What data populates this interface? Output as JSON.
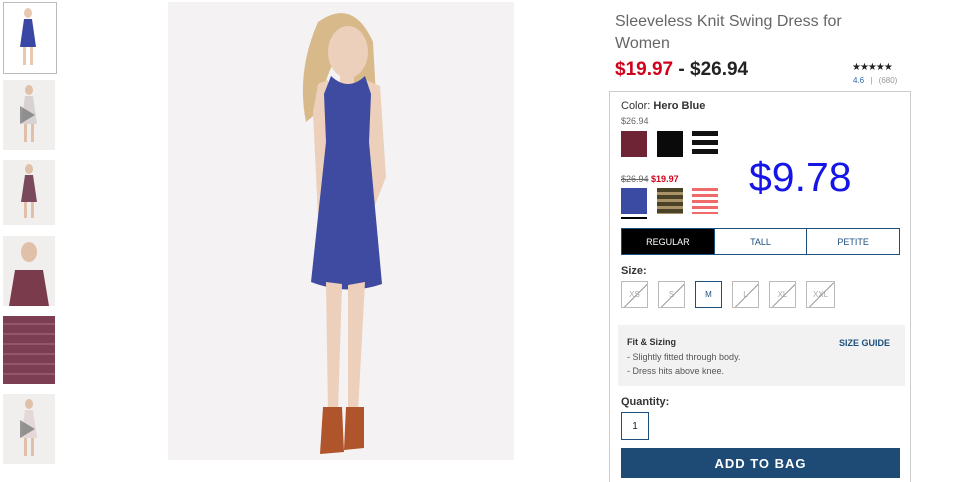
{
  "product": {
    "title": "Sleeveless Knit Swing Dress for Women",
    "sale_price": "$19.97",
    "separator": " - ",
    "regular_price": "$26.94",
    "stars": "★★★★★",
    "rating": "4.6",
    "rating_sep": "|",
    "review_count": "(680)"
  },
  "overlay_price": "$9.78",
  "color": {
    "label": "Color:",
    "selected": "Hero Blue",
    "group1_price": "$26.94",
    "group2_orig_price": "$26.94",
    "group2_sale_price": "$19.97",
    "swatches_group1": [
      "burgundy",
      "black",
      "black-white-stripe"
    ],
    "swatches_group2": [
      "hero-blue",
      "olive-stripe",
      "coral-stripe"
    ]
  },
  "fit_tabs": [
    "REGULAR",
    "TALL",
    "PETITE"
  ],
  "size": {
    "label": "Size:",
    "options": [
      "XS",
      "S",
      "M",
      "L",
      "XL",
      "XXL"
    ],
    "selected": "M"
  },
  "fit_sizing": {
    "title": "Fit & Sizing",
    "guide_label": "SIZE GUIDE",
    "lines": [
      "- Slightly fitted through body.",
      "- Dress hits above knee."
    ]
  },
  "quantity": {
    "label": "Quantity:",
    "value": "1"
  },
  "add_to_bag": "ADD TO BAG"
}
